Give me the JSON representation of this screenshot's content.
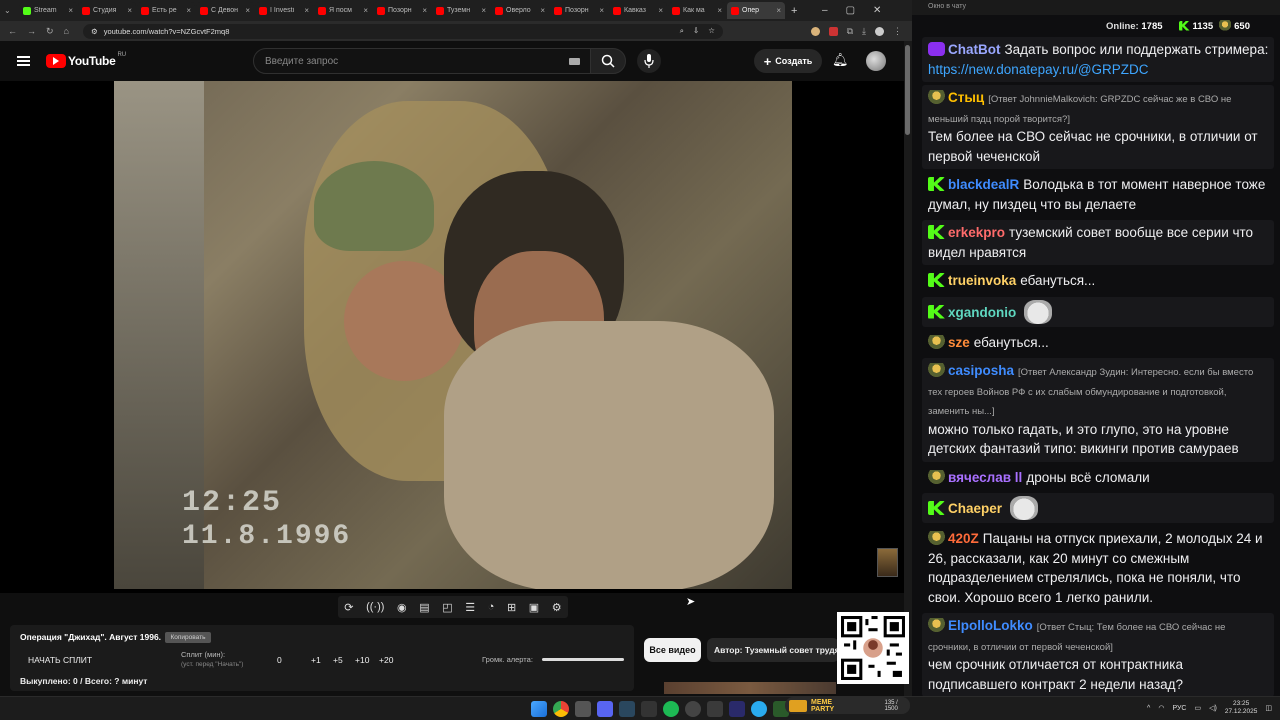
{
  "browser": {
    "tabs": [
      {
        "label": "Stream",
        "color": "#53fc18",
        "active": false
      },
      {
        "label": "Студия",
        "color": "#ff0000",
        "active": false
      },
      {
        "label": "Есть ре",
        "color": "#ff0000",
        "active": false
      },
      {
        "label": "С Девон",
        "color": "#ff0000",
        "active": false
      },
      {
        "label": "I Investi",
        "color": "#ff0000",
        "active": false
      },
      {
        "label": "Я посм",
        "color": "#ff0000",
        "active": false
      },
      {
        "label": "Позорн",
        "color": "#ff0000",
        "active": false
      },
      {
        "label": "Туземн",
        "color": "#ff0000",
        "active": false
      },
      {
        "label": "Оверло",
        "color": "#ff0000",
        "active": false
      },
      {
        "label": "Позорн",
        "color": "#ff0000",
        "active": false
      },
      {
        "label": "Кавказ",
        "color": "#ff0000",
        "active": false
      },
      {
        "label": "Как ма",
        "color": "#ff0000",
        "active": false
      },
      {
        "label": "Опер",
        "color": "#ff0000",
        "active": true
      }
    ],
    "url": "youtube.com/watch?v=NZGcvtF2mq8"
  },
  "youtube": {
    "logo_text": "YouTube",
    "region": "RU",
    "search_placeholder": "Введите запрос",
    "create_label": "Создать",
    "video_stamp_time": "12:25",
    "video_stamp_date": "11.8.1996"
  },
  "player_tools": [
    "loop-icon",
    "cast-icon",
    "watch-icon",
    "clip-icon",
    "picture-in-picture-icon",
    "playlist-icon",
    "speed-icon",
    "add-icon",
    "screenshot-icon",
    "settings-icon"
  ],
  "split_panel": {
    "title": "Операция \"Джихад\". Август 1996.",
    "copy_label": "Копировать",
    "start_label": "НАЧАТЬ СПЛИТ",
    "split_label": "Сплит (мин):",
    "split_hint": "(уст. перед \"Начать\")",
    "steps": [
      "0",
      "+1",
      "+5",
      "+10",
      "+20"
    ],
    "volume_label": "Громк. алерта:",
    "progress_text": "Выкуплено: 0 / Всего: ? минут"
  },
  "buttons": {
    "all_videos": "Все видео",
    "author": "Автор: Туземный совет трудя"
  },
  "memepill": {
    "title": "MEME PARTY",
    "count": "135 / 1500"
  },
  "taskbar": {
    "lang": "РУС",
    "time": "23:25",
    "date": "27.12.2025"
  },
  "chat": {
    "window_title": "Окно в чату",
    "online_label": "Online:",
    "online_count": "1785",
    "kick_count": "1135",
    "other_count": "650",
    "messages": [
      {
        "badge": "bot",
        "user": "ChatBot",
        "color": "#9aa7ff",
        "text": "Задать вопрос или поддержать стримера: ",
        "link": "https://new.donatepay.ru/@GRPZDC",
        "reply": "",
        "emote": false,
        "plain": false
      },
      {
        "badge": "s",
        "user": "Стыц",
        "color": "#ffbf00",
        "reply": "[Ответ JohnnieMalkovich: GRPZDC сейчас же в СВО не меньший пздц порой творится?]",
        "text": "Тем более на СВО сейчас не срочники, в отличии от первой чеченской",
        "link": "",
        "emote": false,
        "plain": false
      },
      {
        "badge": "k",
        "user": "blackdealR",
        "color": "#3f8cff",
        "reply": "",
        "text": "Володька в тот момент наверное тоже думал, ну пиздец что вы делаете",
        "link": "",
        "emote": false,
        "plain": true
      },
      {
        "badge": "k",
        "user": "erkekpro",
        "color": "#ff6b6b",
        "reply": "",
        "text": "туземский совет вообще все серии что видел нравятся",
        "link": "",
        "emote": false,
        "plain": false
      },
      {
        "badge": "k",
        "user": "trueinvoka",
        "color": "#ffd166",
        "reply": "",
        "text": "ебануться...",
        "link": "",
        "emote": false,
        "plain": true
      },
      {
        "badge": "k",
        "user": "xgandonio",
        "color": "#5fd7c0",
        "reply": "",
        "text": "",
        "link": "",
        "emote": true,
        "plain": false
      },
      {
        "badge": "s",
        "user": "sze",
        "color": "#ff8c3a",
        "reply": "",
        "text": "ебануться...",
        "link": "",
        "emote": false,
        "plain": true
      },
      {
        "badge": "s",
        "user": "casiposha",
        "color": "#3f8cff",
        "reply": "[Ответ Александр Зудин: Интересно. если бы вместо тех героев Войнов РФ с их слабым обмундирование и подготовкой, заменить ны...]",
        "text": "можно только гадать, и это глупо, это на уровне детских фантазий типо: викинги против самураев",
        "link": "",
        "emote": false,
        "plain": false
      },
      {
        "badge": "s",
        "user": "вячеслав ll",
        "color": "#a970ff",
        "reply": "",
        "text": "дроны  всё сломали",
        "link": "",
        "emote": false,
        "plain": true
      },
      {
        "badge": "k",
        "user": "Chaeper",
        "color": "#ffd166",
        "reply": "",
        "text": "",
        "link": "",
        "emote": true,
        "plain": false
      },
      {
        "badge": "s",
        "user": "420Z",
        "color": "#ff6b3a",
        "reply": "",
        "text": "Пацаны на отпуск приехали, 2 молодых 24 и 26, рассказали, как 20 минут со смежным подразделением стрелялись, пока не поняли, что свои. Хорошо всего 1 легко ранили.",
        "link": "",
        "emote": false,
        "plain": true
      },
      {
        "badge": "s",
        "user": "ElpolloLokko",
        "color": "#3f8cff",
        "reply": "[Ответ Стыц: Тем более на СВО сейчас не срочники, в отличии от первой чеченской]",
        "text": "чем срочник отличается от контрактника подписавшего контракт 2 недели назад?",
        "link": "",
        "emote": false,
        "plain": false
      }
    ]
  }
}
